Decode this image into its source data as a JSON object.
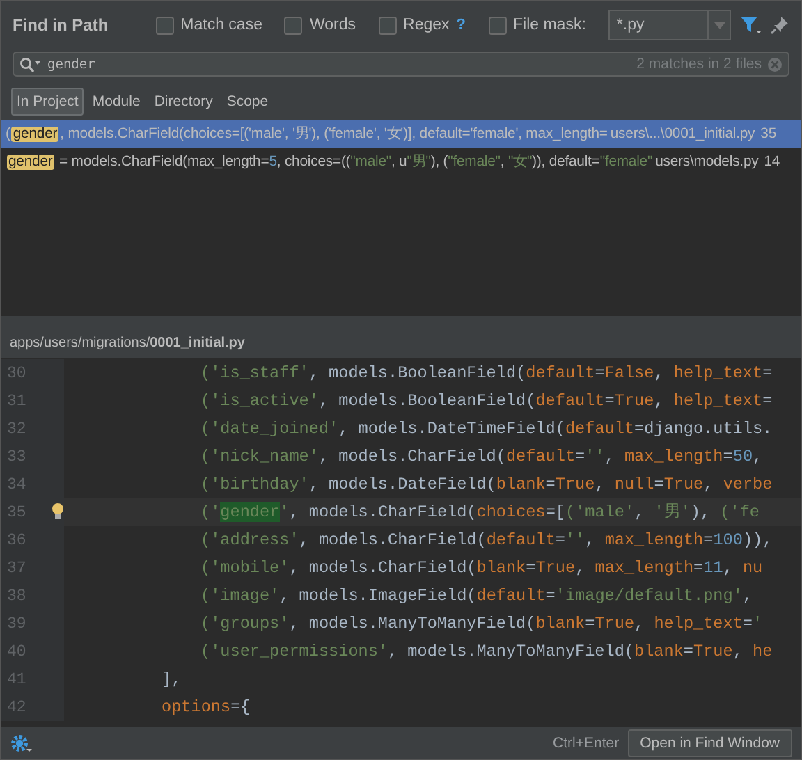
{
  "title": "Find in Path",
  "options": [
    {
      "label": "Match case",
      "checked": false
    },
    {
      "label": "Words",
      "checked": false
    },
    {
      "label": "Regex",
      "checked": false,
      "help": "?"
    }
  ],
  "file_mask": {
    "label": "File mask:",
    "checked": false,
    "value": "*.py"
  },
  "search": {
    "value": "gender",
    "summary": "2 matches in 2 files"
  },
  "scopes": [
    {
      "label": "In Project",
      "selected": true
    },
    {
      "label": "Module",
      "selected": false
    },
    {
      "label": "Directory",
      "selected": false
    },
    {
      "label": "Scope",
      "selected": false
    }
  ],
  "results": [
    {
      "selected": true,
      "tokens": [
        {
          "kind": "plain",
          "t": "("
        },
        {
          "kind": "match",
          "t": "gender"
        },
        {
          "kind": "plain",
          "t": ", models.CharField(choices=[('male', '男'), ('female', '女')], default='female', max_length="
        }
      ],
      "file": "users\\...\\0001_initial.py",
      "line": "35"
    },
    {
      "selected": false,
      "tokens": [
        {
          "kind": "match",
          "t": "gender"
        },
        {
          "kind": "plain",
          "t": " = models.CharField(max_length="
        },
        {
          "kind": "num",
          "t": "5"
        },
        {
          "kind": "plain",
          "t": ", choices=(("
        },
        {
          "kind": "str",
          "t": "\"male\""
        },
        {
          "kind": "plain",
          "t": ", u"
        },
        {
          "kind": "str",
          "t": "\"男\""
        },
        {
          "kind": "plain",
          "t": "), ("
        },
        {
          "kind": "str",
          "t": "\"female\""
        },
        {
          "kind": "plain",
          "t": ", "
        },
        {
          "kind": "str",
          "t": "\"女\""
        },
        {
          "kind": "plain",
          "t": ")), default="
        },
        {
          "kind": "str",
          "t": "\"female\""
        }
      ],
      "file": "users\\models.py",
      "line": "14"
    }
  ],
  "preview_path": "apps/users/migrations/**0001_initial.py**",
  "code": [
    {
      "n": "30",
      "current": false,
      "kind": "inner",
      "tokens": [
        {
          "kind": "str",
          "t": "('is_staff'"
        },
        {
          "kind": "plain",
          "t": ", models.BooleanField("
        },
        {
          "kind": "kw",
          "t": "default"
        },
        {
          "kind": "plain",
          "t": "="
        },
        {
          "kind": "kw",
          "t": "False"
        },
        {
          "kind": "plain",
          "t": ", "
        },
        {
          "kind": "kw",
          "t": "help_text"
        },
        {
          "kind": "plain",
          "t": "="
        }
      ]
    },
    {
      "n": "31",
      "current": false,
      "kind": "inner",
      "tokens": [
        {
          "kind": "str",
          "t": "('is_active'"
        },
        {
          "kind": "plain",
          "t": ", models.BooleanField("
        },
        {
          "kind": "kw",
          "t": "default"
        },
        {
          "kind": "plain",
          "t": "="
        },
        {
          "kind": "kw",
          "t": "True"
        },
        {
          "kind": "plain",
          "t": ", "
        },
        {
          "kind": "kw",
          "t": "help_text"
        },
        {
          "kind": "plain",
          "t": "="
        }
      ]
    },
    {
      "n": "32",
      "current": false,
      "kind": "inner",
      "tokens": [
        {
          "kind": "str",
          "t": "('date_joined'"
        },
        {
          "kind": "plain",
          "t": ", models.DateTimeField("
        },
        {
          "kind": "kw",
          "t": "default"
        },
        {
          "kind": "plain",
          "t": "=django.utils."
        }
      ]
    },
    {
      "n": "33",
      "current": false,
      "kind": "inner",
      "tokens": [
        {
          "kind": "str",
          "t": "('nick_name'"
        },
        {
          "kind": "plain",
          "t": ", models.CharField("
        },
        {
          "kind": "kw",
          "t": "default"
        },
        {
          "kind": "plain",
          "t": "="
        },
        {
          "kind": "str",
          "t": "''"
        },
        {
          "kind": "plain",
          "t": ", "
        },
        {
          "kind": "kw",
          "t": "max_length"
        },
        {
          "kind": "plain",
          "t": "="
        },
        {
          "kind": "num",
          "t": "50"
        },
        {
          "kind": "plain",
          "t": ","
        }
      ]
    },
    {
      "n": "34",
      "current": false,
      "kind": "inner",
      "tokens": [
        {
          "kind": "str",
          "t": "('birthday'"
        },
        {
          "kind": "plain",
          "t": ", models.DateField("
        },
        {
          "kind": "kw",
          "t": "blank"
        },
        {
          "kind": "plain",
          "t": "="
        },
        {
          "kind": "kw",
          "t": "True"
        },
        {
          "kind": "plain",
          "t": ", "
        },
        {
          "kind": "kw",
          "t": "null"
        },
        {
          "kind": "plain",
          "t": "="
        },
        {
          "kind": "kw",
          "t": "True"
        },
        {
          "kind": "plain",
          "t": ", "
        },
        {
          "kind": "kw",
          "t": "verbe"
        }
      ]
    },
    {
      "n": "35",
      "current": true,
      "kind": "inner",
      "tokens": [
        {
          "kind": "str",
          "t": "('"
        },
        {
          "kind": "match",
          "t": "gender"
        },
        {
          "kind": "str",
          "t": "'"
        },
        {
          "kind": "plain",
          "t": ", models.CharField("
        },
        {
          "kind": "kw",
          "t": "choices"
        },
        {
          "kind": "plain",
          "t": "=["
        },
        {
          "kind": "str",
          "t": "('male'"
        },
        {
          "kind": "plain",
          "t": ", "
        },
        {
          "kind": "str",
          "t": "'男'"
        },
        {
          "kind": "plain",
          "t": "), "
        },
        {
          "kind": "str",
          "t": "('fe"
        }
      ]
    },
    {
      "n": "36",
      "current": false,
      "kind": "inner",
      "tokens": [
        {
          "kind": "str",
          "t": "('address'"
        },
        {
          "kind": "plain",
          "t": ", models.CharField("
        },
        {
          "kind": "kw",
          "t": "default"
        },
        {
          "kind": "plain",
          "t": "="
        },
        {
          "kind": "str",
          "t": "''"
        },
        {
          "kind": "plain",
          "t": ", "
        },
        {
          "kind": "kw",
          "t": "max_length"
        },
        {
          "kind": "plain",
          "t": "="
        },
        {
          "kind": "num",
          "t": "100"
        },
        {
          "kind": "plain",
          "t": ")),"
        }
      ]
    },
    {
      "n": "37",
      "current": false,
      "kind": "inner",
      "tokens": [
        {
          "kind": "str",
          "t": "('mobile'"
        },
        {
          "kind": "plain",
          "t": ", models.CharField("
        },
        {
          "kind": "kw",
          "t": "blank"
        },
        {
          "kind": "plain",
          "t": "="
        },
        {
          "kind": "kw",
          "t": "True"
        },
        {
          "kind": "plain",
          "t": ", "
        },
        {
          "kind": "kw",
          "t": "max_length"
        },
        {
          "kind": "plain",
          "t": "="
        },
        {
          "kind": "num",
          "t": "11"
        },
        {
          "kind": "plain",
          "t": ", "
        },
        {
          "kind": "kw",
          "t": "nu"
        }
      ]
    },
    {
      "n": "38",
      "current": false,
      "kind": "inner",
      "tokens": [
        {
          "kind": "str",
          "t": "('image'"
        },
        {
          "kind": "plain",
          "t": ", models.ImageField("
        },
        {
          "kind": "kw",
          "t": "default"
        },
        {
          "kind": "plain",
          "t": "="
        },
        {
          "kind": "str",
          "t": "'image/default.png'"
        },
        {
          "kind": "plain",
          "t": ","
        }
      ]
    },
    {
      "n": "39",
      "current": false,
      "kind": "inner",
      "tokens": [
        {
          "kind": "str",
          "t": "('groups'"
        },
        {
          "kind": "plain",
          "t": ", models.ManyToManyField("
        },
        {
          "kind": "kw",
          "t": "blank"
        },
        {
          "kind": "plain",
          "t": "="
        },
        {
          "kind": "kw",
          "t": "True"
        },
        {
          "kind": "plain",
          "t": ", "
        },
        {
          "kind": "kw",
          "t": "help_text"
        },
        {
          "kind": "plain",
          "t": "="
        },
        {
          "kind": "str",
          "t": "'"
        }
      ]
    },
    {
      "n": "40",
      "current": false,
      "kind": "inner",
      "tokens": [
        {
          "kind": "str",
          "t": "('user_permissions'"
        },
        {
          "kind": "plain",
          "t": ", models.ManyToManyField("
        },
        {
          "kind": "kw",
          "t": "blank"
        },
        {
          "kind": "plain",
          "t": "="
        },
        {
          "kind": "kw",
          "t": "True"
        },
        {
          "kind": "plain",
          "t": ", "
        },
        {
          "kind": "kw",
          "t": "he"
        }
      ]
    },
    {
      "n": "41",
      "current": false,
      "kind": "outer",
      "tokens": [
        {
          "kind": "plain",
          "t": "],"
        }
      ]
    },
    {
      "n": "42",
      "current": false,
      "kind": "outer",
      "tokens": [
        {
          "kind": "kw",
          "t": "options"
        },
        {
          "kind": "plain",
          "t": "={"
        }
      ]
    }
  ],
  "footer": {
    "shortcut": "Ctrl+Enter",
    "button": "Open in Find Window"
  }
}
